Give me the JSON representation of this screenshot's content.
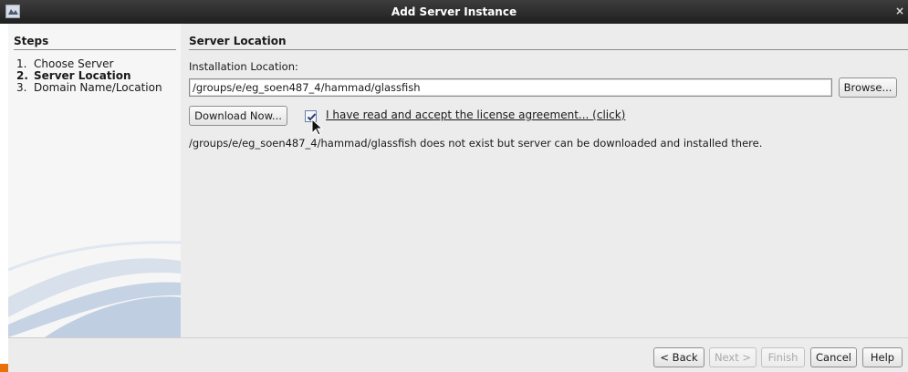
{
  "window": {
    "title": "Add Server Instance",
    "close_glyph": "×"
  },
  "steps": {
    "heading": "Steps",
    "items": [
      {
        "num": "1.",
        "label": "Choose Server",
        "current": false
      },
      {
        "num": "2.",
        "label": "Server Location",
        "current": true
      },
      {
        "num": "3.",
        "label": "Domain Name/Location",
        "current": false
      }
    ]
  },
  "content": {
    "heading": "Server Location",
    "installation_label": "Installation Location:",
    "installation_path": "/groups/e/eg_soen487_4/hammad/glassfish",
    "browse_label": "Browse...",
    "download_label": "Download Now...",
    "license_checked": true,
    "license_label": "I have read and accept the license agreement... (click)",
    "status_message": "/groups/e/eg_soen487_4/hammad/glassfish does not exist but server can be downloaded and installed there."
  },
  "footer": {
    "back_label": "< Back",
    "next_label": "Next >",
    "finish_label": "Finish",
    "cancel_label": "Cancel",
    "help_label": "Help"
  },
  "icons": {
    "app": "app-icon",
    "close": "close-icon",
    "check": "checkmark-icon",
    "cursor": "mouse-pointer-icon"
  },
  "colors": {
    "titlebar": "#2b2b2b",
    "dialog_bg": "#ececec",
    "accent_orange": "#e8710a"
  }
}
